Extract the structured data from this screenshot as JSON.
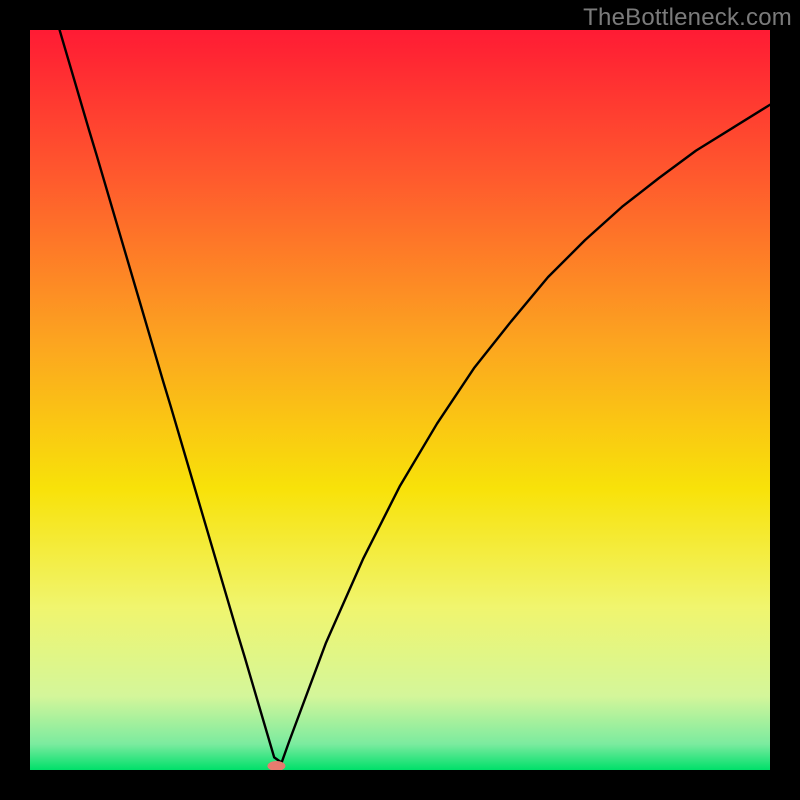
{
  "attribution": "TheBottleneck.com",
  "chart_data": {
    "type": "line",
    "title": "",
    "xlabel": "",
    "ylabel": "",
    "xlim": [
      0,
      100
    ],
    "ylim": [
      0,
      100
    ],
    "x": [
      4,
      5,
      6,
      7,
      8,
      9,
      10,
      11,
      12,
      13,
      14,
      15,
      16,
      17,
      18,
      19,
      20,
      21,
      22,
      23,
      24,
      25,
      26,
      27,
      28,
      29,
      30,
      31,
      32,
      33,
      34,
      35,
      40,
      45,
      50,
      55,
      60,
      65,
      70,
      75,
      80,
      85,
      90,
      95,
      100
    ],
    "values": [
      100,
      96.6,
      93.2,
      89.8,
      86.4,
      83.1,
      79.7,
      76.3,
      72.9,
      69.5,
      66.1,
      62.7,
      59.3,
      55.9,
      52.5,
      49.2,
      45.8,
      42.4,
      39.0,
      35.6,
      32.2,
      28.8,
      25.4,
      22.0,
      18.6,
      15.3,
      11.9,
      8.5,
      5.1,
      1.7,
      1.0,
      3.8,
      17.2,
      28.5,
      38.4,
      46.8,
      54.3,
      60.6,
      66.6,
      71.6,
      76.1,
      80.0,
      83.7,
      86.8,
      89.9
    ],
    "notch": {
      "x": 33.3,
      "y": 0
    },
    "gradient_stops": [
      {
        "offset": 0.0,
        "color": "#ff1b34"
      },
      {
        "offset": 0.2,
        "color": "#ff5a2d"
      },
      {
        "offset": 0.42,
        "color": "#fca420"
      },
      {
        "offset": 0.62,
        "color": "#f8e209"
      },
      {
        "offset": 0.78,
        "color": "#f0f56e"
      },
      {
        "offset": 0.9,
        "color": "#d4f69a"
      },
      {
        "offset": 0.965,
        "color": "#7beb9f"
      },
      {
        "offset": 1.0,
        "color": "#00e06a"
      }
    ]
  }
}
